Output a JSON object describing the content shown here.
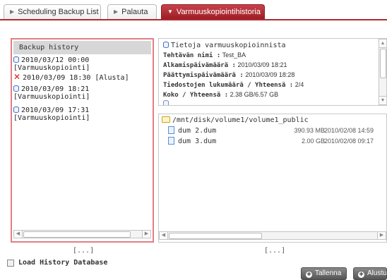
{
  "tabs": [
    {
      "label": "Scheduling Backup List",
      "active": false
    },
    {
      "label": "Palauta",
      "active": false
    },
    {
      "label": "Varmuuskopiointihistoria",
      "active": true
    }
  ],
  "history": {
    "header": "Backup history",
    "entries": [
      {
        "icon": "database-icon",
        "date": "2010/03/12 00:00",
        "type": "[Varmuuskopiointi]"
      },
      {
        "icon": "error-x-icon",
        "date": "2010/03/09 18:30",
        "type": "[Alusta]"
      },
      {
        "icon": "database-icon",
        "date": "2010/03/09 18:21",
        "type": "[Varmuuskopiointi]"
      },
      {
        "icon": "database-icon",
        "date": "2010/03/09 17:31",
        "type": "[Varmuuskopiointi]"
      }
    ],
    "more": "[...]"
  },
  "info": {
    "title": "Tietoja varmuuskopioinnista",
    "task_name_label": "Tehtävän nimi :",
    "task_name_value": "Test_BA",
    "start_label": "Alkamispäivämäärä :",
    "start_value": "2010/03/09 18:21",
    "end_label": "Päättymispäivämäärä :",
    "end_value": "2010/03/09 18:28",
    "files_label": "Tiedostojen lukumäärä / Yhteensä :",
    "files_value": "2/4",
    "size_label": "Koko / Yhteensä :",
    "size_value": "2.38 GB/6.57 GB"
  },
  "files": {
    "folder": "/mnt/disk/volume1/volume1_public",
    "items": [
      {
        "name": "dum 2.dum",
        "size": "390.93 MB",
        "date": "2010/02/08 14:59"
      },
      {
        "name": "dum 3.dum",
        "size": "2.00 GB",
        "date": "2010/02/08 09:17"
      }
    ],
    "more": "[...]"
  },
  "load_history_label": "Load History Database",
  "buttons": {
    "save": "Tallenna",
    "reset": "Alustus"
  },
  "colors": {
    "active_tab": "#b02a31",
    "left_panel_border": "#e37d84",
    "error_icon": "#e01818"
  }
}
